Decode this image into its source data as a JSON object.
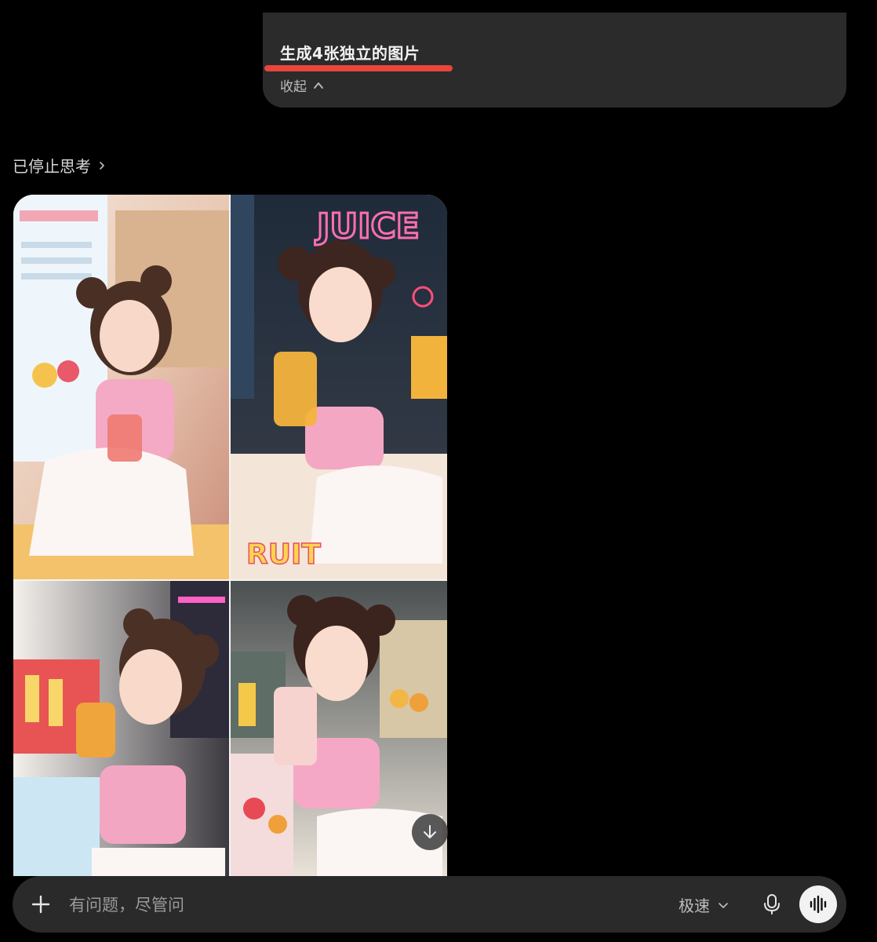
{
  "user_message": {
    "text": "生成4张独立的图片",
    "collapse_label": "收起",
    "underline_color": "#e8453c"
  },
  "response": {
    "thinking_status": "已停止思考",
    "images": [
      {
        "icon": "image-1-girl-juice-shop-pink-top"
      },
      {
        "icon": "image-2-girl-neon-juice-sign"
      },
      {
        "icon": "image-3-girl-orange-drink"
      },
      {
        "icon": "image-4-girl-strawberry-drink"
      }
    ],
    "download_icon": "arrow-down-icon"
  },
  "composer": {
    "placeholder": "有问题，尽管问",
    "mode_label": "极速",
    "plus_icon": "plus-icon",
    "mic_icon": "microphone-icon",
    "voice_icon": "voice-waveform-icon"
  },
  "colors": {
    "background": "#000000",
    "bubble": "#2b2b2b",
    "composer": "#2a2a2a"
  }
}
